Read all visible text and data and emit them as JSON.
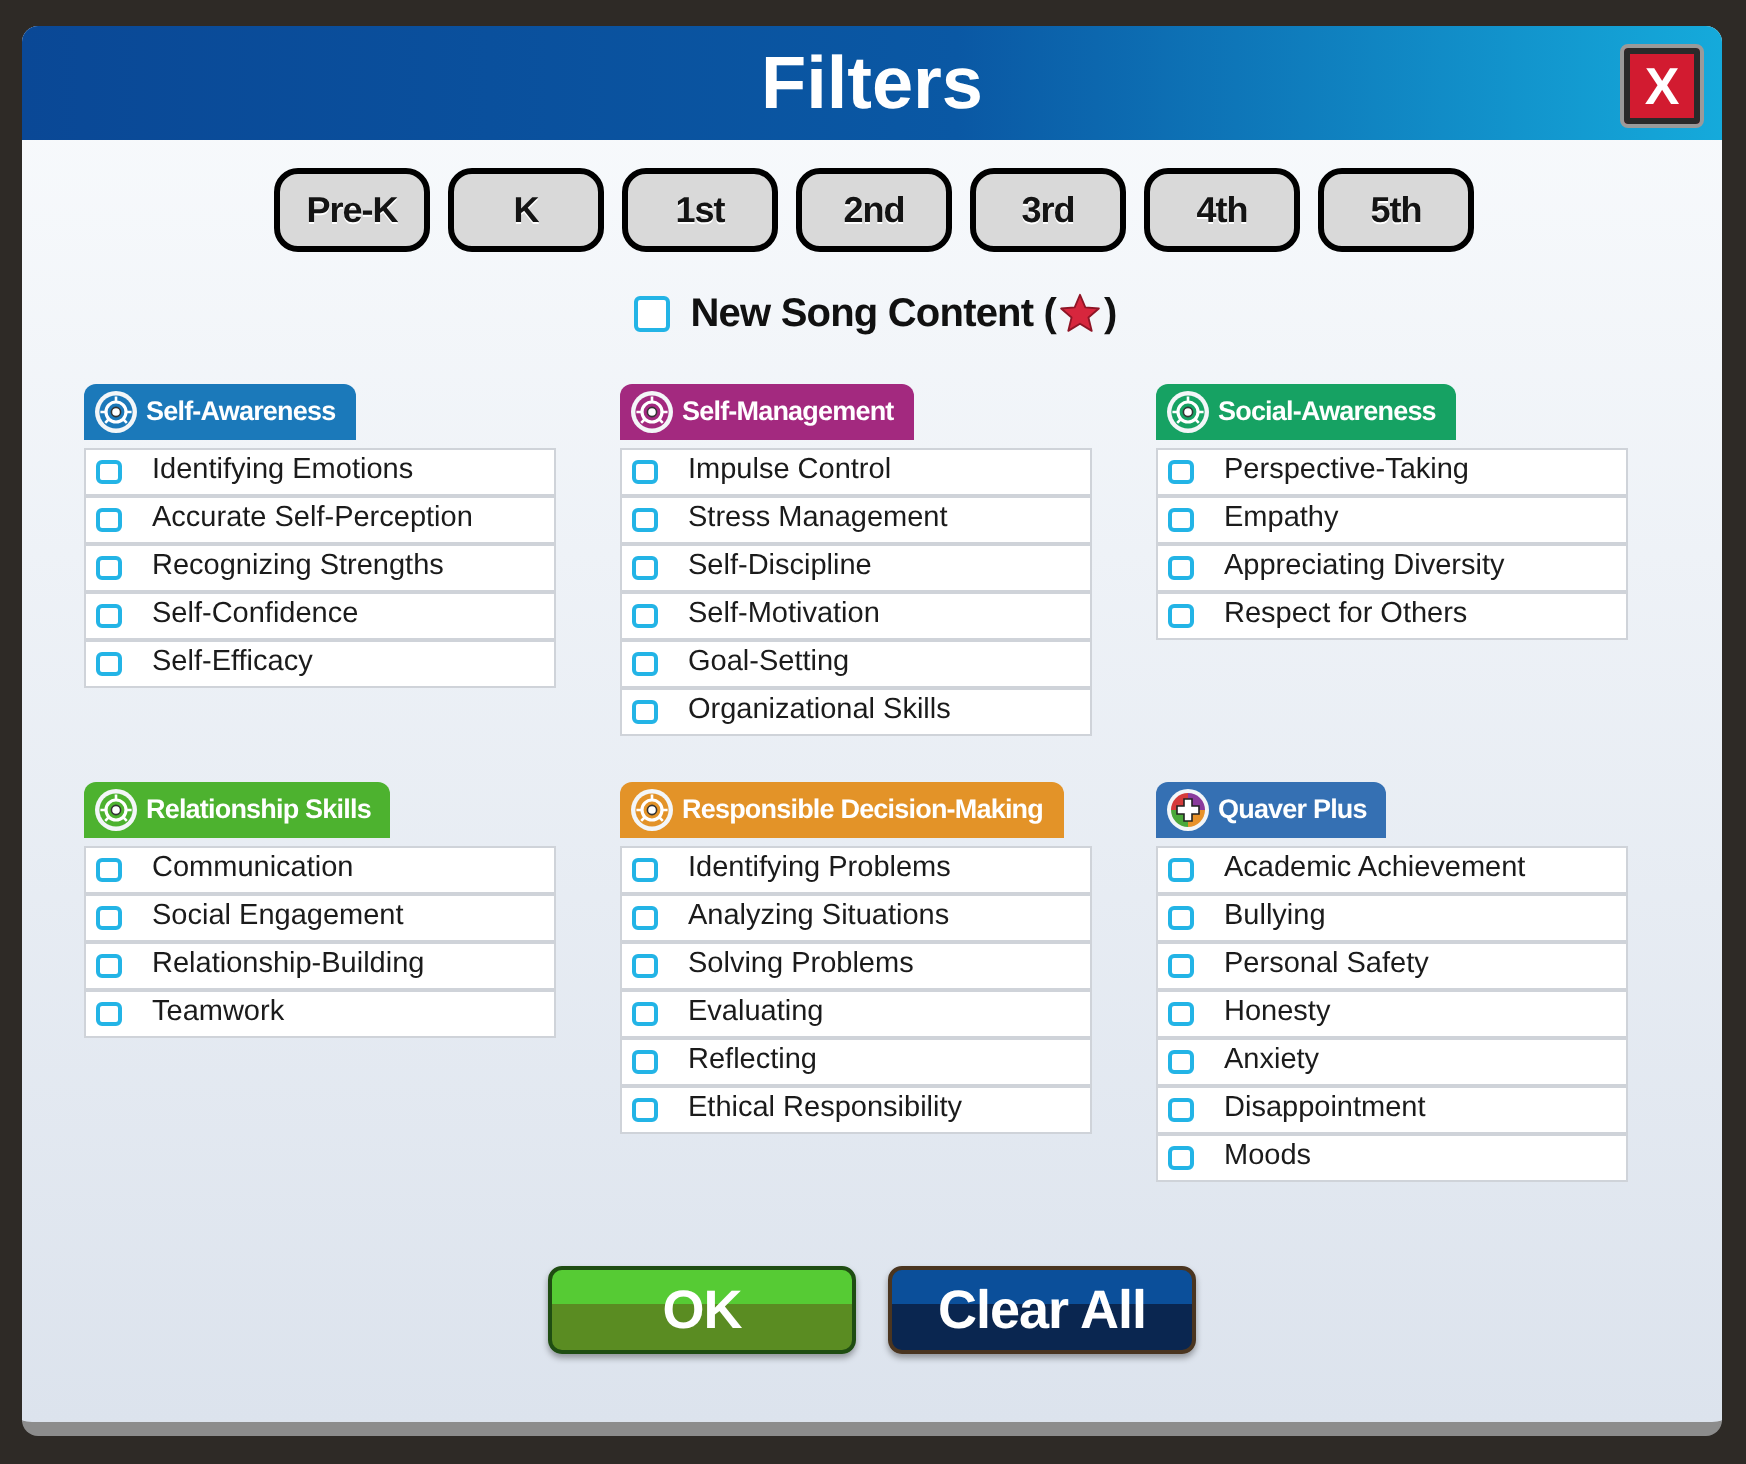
{
  "window": {
    "title": "Filters"
  },
  "close_button": {
    "label": "X"
  },
  "grades": [
    {
      "label": "Pre-K",
      "selected": false
    },
    {
      "label": "K",
      "selected": false
    },
    {
      "label": "1st",
      "selected": false
    },
    {
      "label": "2nd",
      "selected": false
    },
    {
      "label": "3rd",
      "selected": false
    },
    {
      "label": "4th",
      "selected": false
    },
    {
      "label": "5th",
      "selected": false
    }
  ],
  "new_song_content": {
    "label": "New Song Content (",
    "label_end": ")",
    "checked": false
  },
  "categories": [
    {
      "title": "Self-Awareness",
      "kind": "wheel",
      "color": "#1b79ba",
      "options": [
        {
          "label": "Identifying Emotions",
          "checked": false
        },
        {
          "label": "Accurate Self-Perception",
          "checked": false
        },
        {
          "label": "Recognizing Strengths",
          "checked": false
        },
        {
          "label": "Self-Confidence",
          "checked": false
        },
        {
          "label": "Self-Efficacy",
          "checked": false
        }
      ]
    },
    {
      "title": "Self-Management",
      "kind": "wheel",
      "color": "#a3297f",
      "options": [
        {
          "label": "Impulse Control",
          "checked": false
        },
        {
          "label": "Stress Management",
          "checked": false
        },
        {
          "label": "Self-Discipline",
          "checked": false
        },
        {
          "label": "Self-Motivation",
          "checked": false
        },
        {
          "label": "Goal-Setting",
          "checked": false
        },
        {
          "label": "Organizational Skills",
          "checked": false
        }
      ]
    },
    {
      "title": "Social-Awareness",
      "kind": "wheel",
      "color": "#16a263",
      "options": [
        {
          "label": "Perspective-Taking",
          "checked": false
        },
        {
          "label": "Empathy",
          "checked": false
        },
        {
          "label": "Appreciating Diversity",
          "checked": false
        },
        {
          "label": "Respect for Others",
          "checked": false
        }
      ]
    },
    {
      "title": "Relationship Skills",
      "kind": "wheel",
      "color": "#4db22f",
      "options": [
        {
          "label": "Communication",
          "checked": false
        },
        {
          "label": "Social Engagement",
          "checked": false
        },
        {
          "label": "Relationship-Building",
          "checked": false
        },
        {
          "label": "Teamwork",
          "checked": false
        }
      ]
    },
    {
      "title": "Responsible Decision-Making",
      "kind": "wheel",
      "color": "#e39328",
      "options": [
        {
          "label": "Identifying Problems",
          "checked": false
        },
        {
          "label": "Analyzing Situations",
          "checked": false
        },
        {
          "label": "Solving Problems",
          "checked": false
        },
        {
          "label": "Evaluating",
          "checked": false
        },
        {
          "label": "Reflecting",
          "checked": false
        },
        {
          "label": "Ethical Responsibility",
          "checked": false
        }
      ]
    },
    {
      "title": "Quaver Plus",
      "kind": "plus",
      "color": "#3570b3",
      "options": [
        {
          "label": "Academic Achievement",
          "checked": false
        },
        {
          "label": "Bullying",
          "checked": false
        },
        {
          "label": "Personal Safety",
          "checked": false
        },
        {
          "label": "Honesty",
          "checked": false
        },
        {
          "label": "Anxiety",
          "checked": false
        },
        {
          "label": "Disappointment",
          "checked": false
        },
        {
          "label": "Moods",
          "checked": false
        }
      ]
    }
  ],
  "buttons": [
    {
      "label": "OK",
      "kind": "ok"
    },
    {
      "label": "Clear All",
      "kind": "clear"
    }
  ]
}
